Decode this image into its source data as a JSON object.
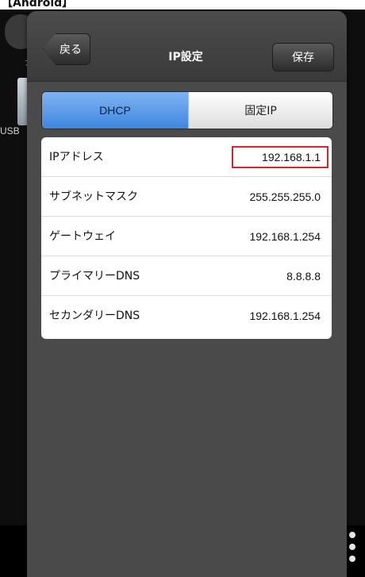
{
  "caption": "【Android】",
  "background": {
    "usb_label": "USB",
    "partial_label": "ァ"
  },
  "dialog": {
    "back_label": "戻る",
    "title": "IP設定",
    "save_label": "保存"
  },
  "segment": {
    "options": [
      "DHCP",
      "固定IP"
    ],
    "selected": "DHCP"
  },
  "fields": [
    {
      "label": "IPアドレス",
      "value": "192.168.1.1",
      "highlighted": true
    },
    {
      "label": "サブネットマスク",
      "value": "255.255.255.0"
    },
    {
      "label": "ゲートウェイ",
      "value": "192.168.1.254"
    },
    {
      "label": "プライマリーDNS",
      "value": "8.8.8.8"
    },
    {
      "label": "セカンダリーDNS",
      "value": "192.168.1.254"
    }
  ],
  "colors": {
    "highlight_border": "#d6252f",
    "segment_selected": "#3f86e0",
    "dialog_bg": "#4a4a4a"
  },
  "icons": {
    "back": "back-arrow-button",
    "overflow_menu": "vertical-dots-icon",
    "usb": "usb-drive-icon"
  }
}
